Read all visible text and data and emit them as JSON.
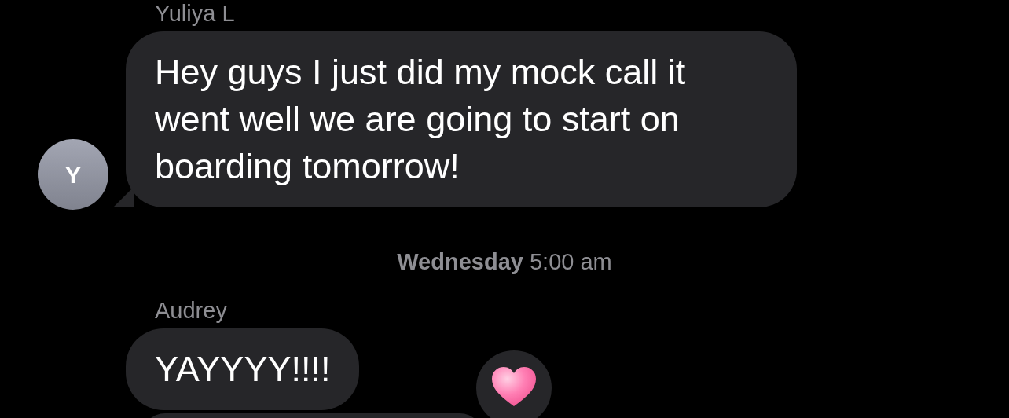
{
  "messages": [
    {
      "kind": "group",
      "sender": "Yuliya L",
      "avatar": "Y",
      "bubbles": [
        {
          "kind": "text",
          "text": "Hey guys I just did my mock call it went well we are going to start on boarding tomorrow!",
          "hearted": false
        }
      ]
    },
    {
      "kind": "timestamp",
      "text": "**Wednesday** 5:00 am"
    },
    {
      "kind": "group",
      "sender": "Audrey",
      "bubbles": [
        {
          "kind": "text",
          "text": "YAYYYY!!!!",
          "hearted": true
        },
        {
          "kind": "cut"
        }
      ]
    }
  ]
}
